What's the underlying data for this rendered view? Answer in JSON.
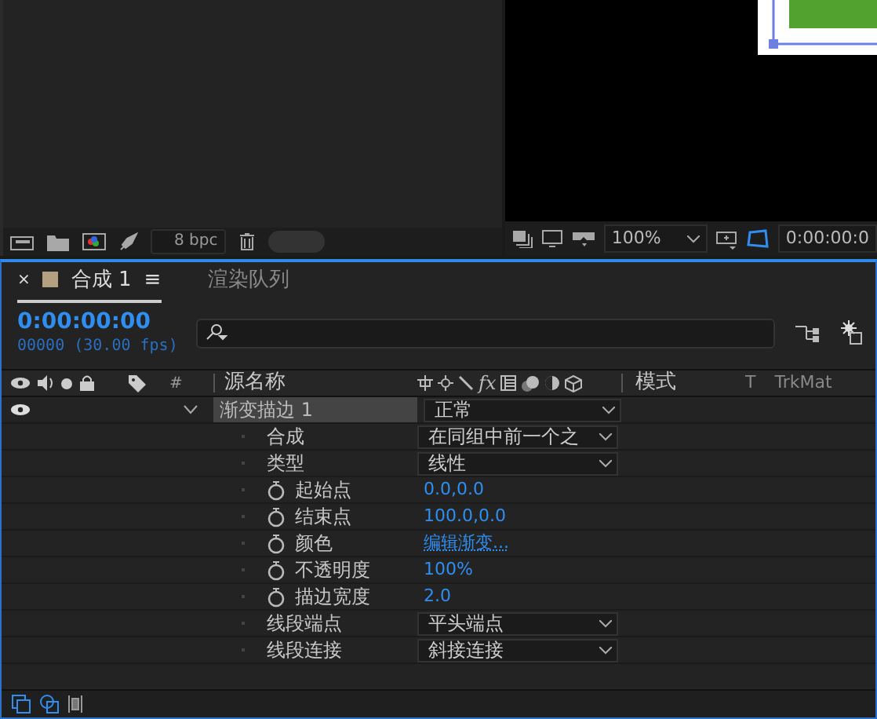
{
  "project_panel": {
    "bit_depth": "8 bpc"
  },
  "viewer": {
    "zoom": "100%",
    "timecode": "0:00:00:0"
  },
  "timeline": {
    "tabs": [
      {
        "label": "合成 1",
        "selected": true,
        "close": "×",
        "menu": "≡"
      },
      {
        "label": "渲染队列",
        "selected": false
      }
    ],
    "timecode": "0:00:00:00",
    "frame_info": "00000 (30.00 fps)",
    "columns": {
      "number": "#",
      "source_name": "源名称",
      "fx": "fx",
      "mode": "模式",
      "t": "T",
      "trkmat": "TrkMat"
    },
    "layer": {
      "name": "渐变描边 1",
      "visible": true,
      "expanded": true,
      "selected": true,
      "mode": "正常"
    },
    "properties": [
      {
        "kind": "dropdown",
        "name": "合成",
        "value": "在同组中前一个之",
        "stopwatch": false
      },
      {
        "kind": "dropdown",
        "name": "类型",
        "value": "线性",
        "stopwatch": false
      },
      {
        "kind": "value",
        "name": "起始点",
        "value": "0.0,0.0",
        "stopwatch": true
      },
      {
        "kind": "value",
        "name": "结束点",
        "value": "100.0,0.0",
        "stopwatch": true
      },
      {
        "kind": "link",
        "name": "颜色",
        "value": "编辑渐变...",
        "stopwatch": true
      },
      {
        "kind": "value",
        "name": "不透明度",
        "value": "100%",
        "stopwatch": true
      },
      {
        "kind": "value",
        "name": "描边宽度",
        "value": "2.0",
        "stopwatch": true
      },
      {
        "kind": "dropdown",
        "name": "线段端点",
        "value": "平头端点",
        "stopwatch": false
      },
      {
        "kind": "dropdown",
        "name": "线段连接",
        "value": "斜接连接",
        "stopwatch": false
      }
    ]
  }
}
